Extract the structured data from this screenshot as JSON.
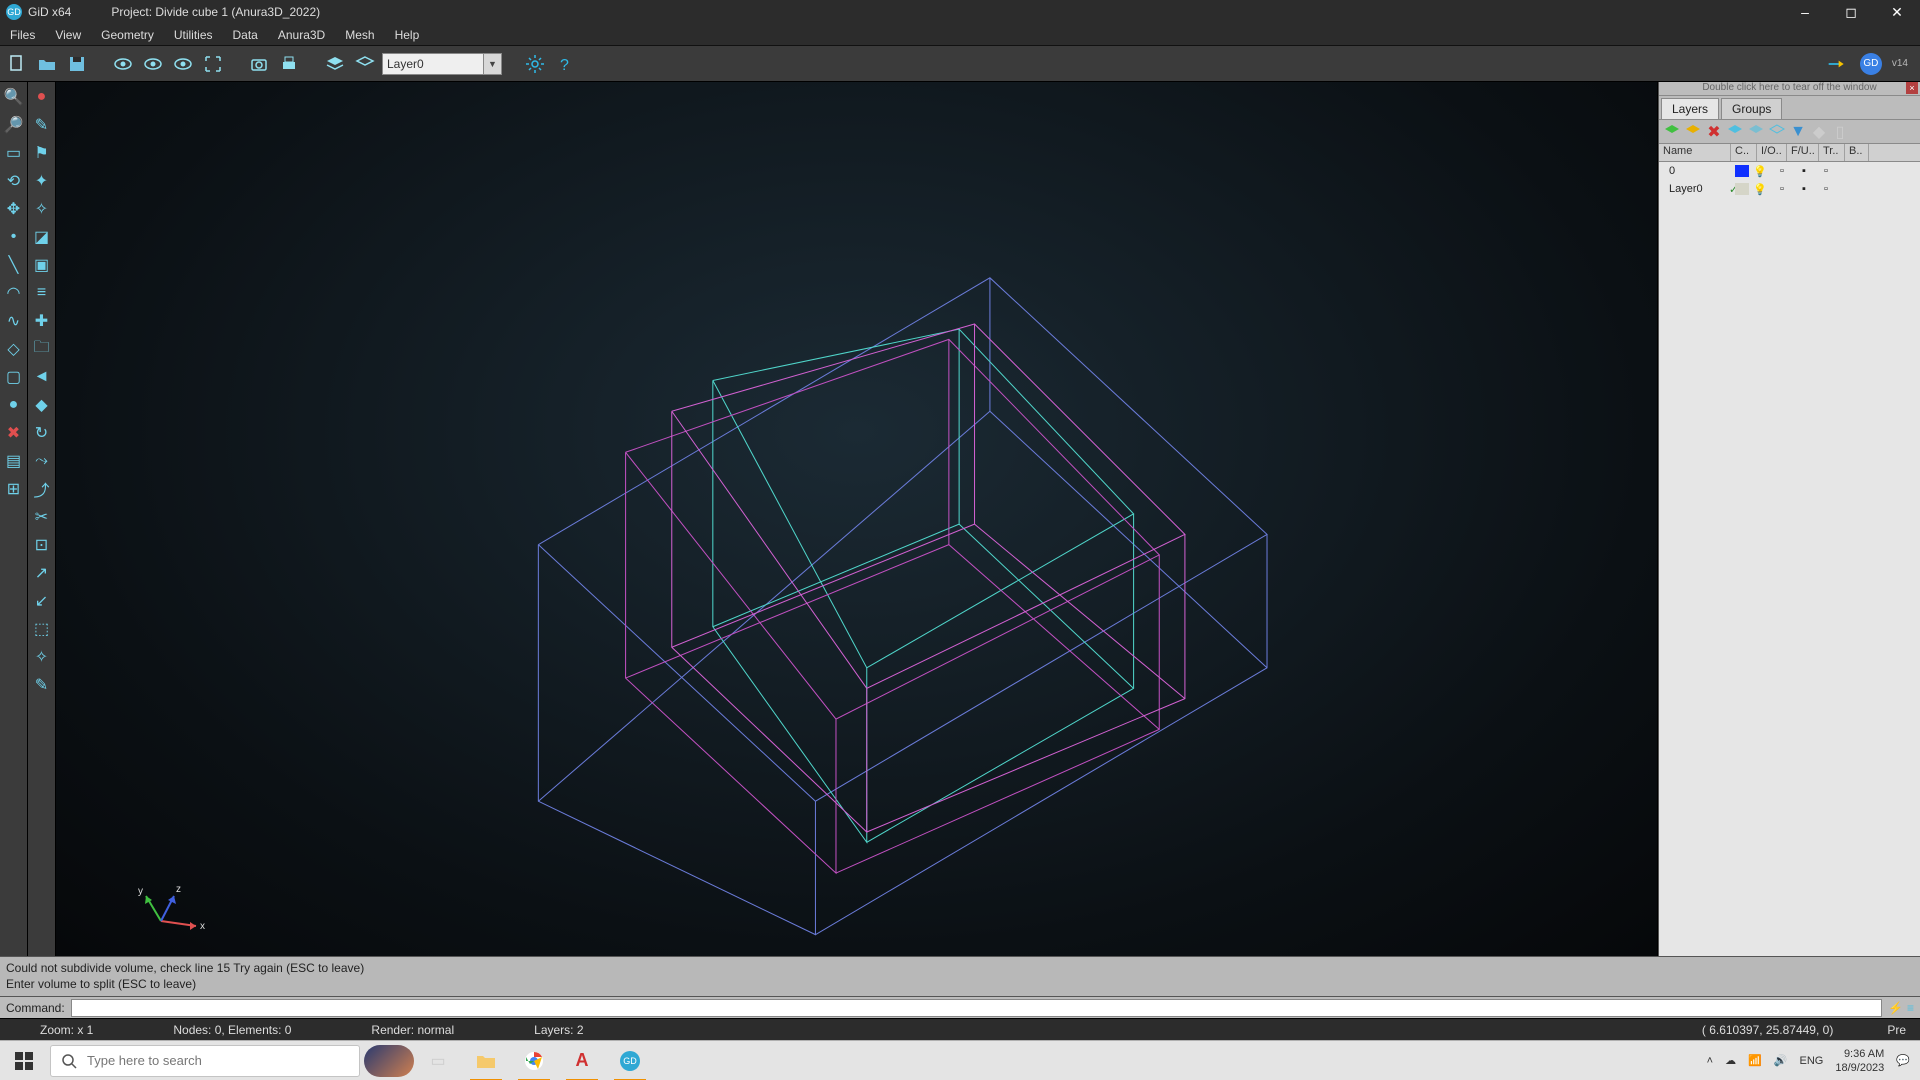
{
  "title": {
    "app": "GiD x64",
    "project": "Project: Divide cube 1 (Anura3D_2022)"
  },
  "menu": [
    "Files",
    "View",
    "Geometry",
    "Utilities",
    "Data",
    "Anura3D",
    "Mesh",
    "Help"
  ],
  "toolbar": {
    "layer_selected": "Layer0",
    "version": "v14",
    "avatar": "GD"
  },
  "layers_panel": {
    "tearoff": "Double click here to tear off the window",
    "tabs": [
      "Layers",
      "Groups"
    ],
    "headers": [
      "Name",
      "C..",
      "I/O..",
      "F/U..",
      "Tr..",
      "B.."
    ],
    "rows": [
      {
        "name": "0",
        "color": "#1030ff"
      },
      {
        "name": "Layer0",
        "color": "#d5d5c8",
        "check": true
      }
    ]
  },
  "messages": {
    "line1": "Could not subdivide volume, check line 15 Try again (ESC to leave)",
    "line2": "Enter volume to split (ESC to leave)"
  },
  "command": {
    "label": "Command:",
    "value": ""
  },
  "status": {
    "zoom": "Zoom: x 1",
    "nodes": "Nodes: 0, Elements: 0",
    "render": "Render: normal",
    "layers": "Layers: 2",
    "coords": "(  6.610397,  25.87449,  0)",
    "mode": "Pre"
  },
  "taskbar": {
    "search_placeholder": "Type here to search",
    "time": "9:36 AM",
    "date": "18/9/2023",
    "lang": "ENG"
  },
  "axes": {
    "x": "x",
    "y": "y",
    "z": "z"
  }
}
